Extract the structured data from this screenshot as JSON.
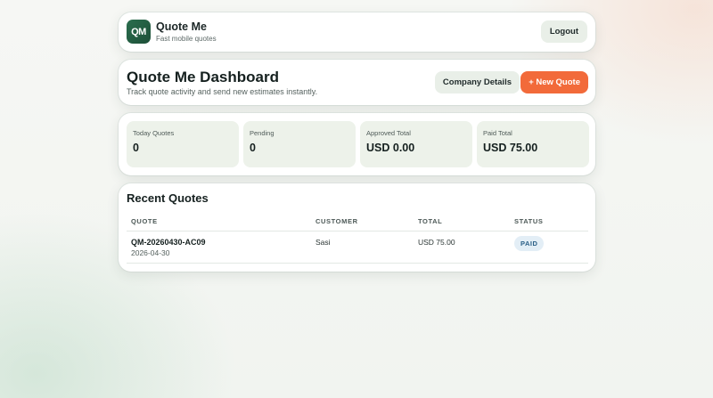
{
  "header": {
    "logo_text": "QM",
    "app_name": "Quote Me",
    "tagline": "Fast mobile quotes",
    "logout_label": "Logout"
  },
  "dashboard": {
    "title": "Quote Me Dashboard",
    "subtitle": "Track quote activity and send new estimates instantly.",
    "company_details_label": "Company Details",
    "new_quote_label": "+ New Quote"
  },
  "stats": [
    {
      "label": "Today Quotes",
      "value": "0"
    },
    {
      "label": "Pending",
      "value": "0"
    },
    {
      "label": "Approved Total",
      "value": "USD 0.00"
    },
    {
      "label": "Paid Total",
      "value": "USD 75.00"
    }
  ],
  "recent": {
    "title": "Recent Quotes",
    "columns": [
      "QUOTE",
      "CUSTOMER",
      "TOTAL",
      "STATUS"
    ],
    "rows": [
      {
        "quote_id": "QM-20260430-AC09",
        "date": "2026-04-30",
        "customer": "Sasi",
        "total": "USD 75.00",
        "status": "PAID"
      }
    ]
  },
  "colors": {
    "accent": "#f26a3a",
    "brand": "#2b6e4e",
    "status_paid_bg": "#e3eef6"
  }
}
